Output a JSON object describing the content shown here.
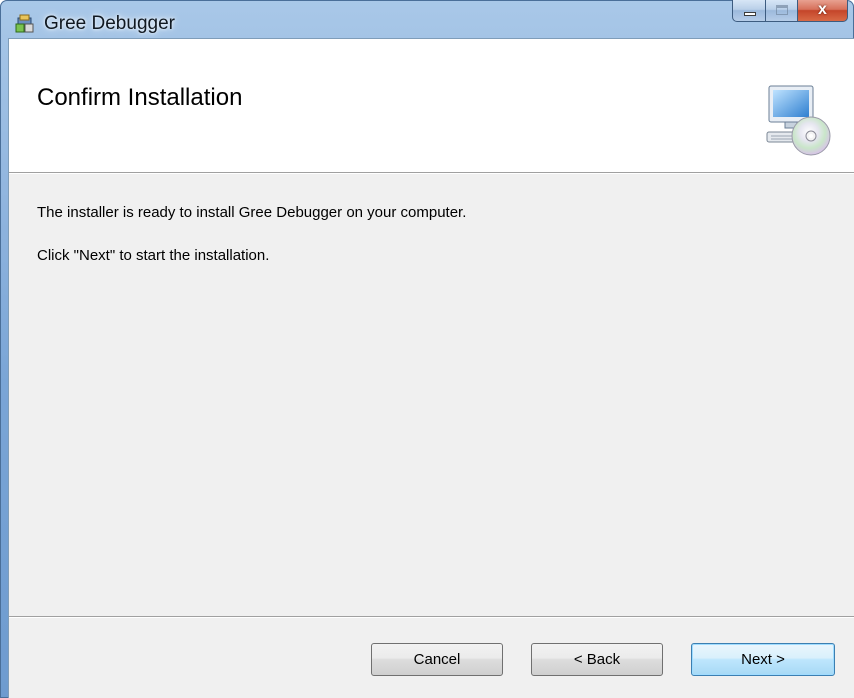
{
  "window": {
    "title": "Gree Debugger",
    "app_icon": "installer-package-icon",
    "caption_buttons": {
      "minimize_icon": "minimize-icon",
      "maximize_icon": "maximize-icon",
      "close_label": "x"
    }
  },
  "banner": {
    "title": "Confirm Installation",
    "icon": "computer-cd-icon"
  },
  "body": {
    "line1": "The installer is ready to install Gree Debugger on your computer.",
    "line2": "Click \"Next\" to start the installation."
  },
  "footer": {
    "cancel_label": "Cancel",
    "back_label": "< Back",
    "next_label": "Next >"
  },
  "colors": {
    "frame": "#7aa5d6",
    "client_bg": "#f0f0f0",
    "banner_bg": "#ffffff",
    "close_button": "#c4452a",
    "default_button_border": "#3c7fb1"
  }
}
